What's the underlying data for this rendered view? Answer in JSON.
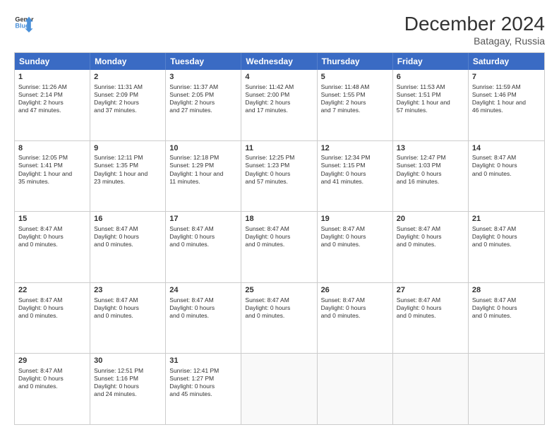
{
  "logo": {
    "line1": "General",
    "line2": "Blue",
    "icon_color": "#4a90d9"
  },
  "title": "December 2024",
  "location": "Batagay, Russia",
  "header_days": [
    "Sunday",
    "Monday",
    "Tuesday",
    "Wednesday",
    "Thursday",
    "Friday",
    "Saturday"
  ],
  "rows": [
    [
      {
        "day": "1",
        "info": "Sunrise: 11:26 AM\nSunset: 2:14 PM\nDaylight: 2 hours\nand 47 minutes."
      },
      {
        "day": "2",
        "info": "Sunrise: 11:31 AM\nSunset: 2:09 PM\nDaylight: 2 hours\nand 37 minutes."
      },
      {
        "day": "3",
        "info": "Sunrise: 11:37 AM\nSunset: 2:05 PM\nDaylight: 2 hours\nand 27 minutes."
      },
      {
        "day": "4",
        "info": "Sunrise: 11:42 AM\nSunset: 2:00 PM\nDaylight: 2 hours\nand 17 minutes."
      },
      {
        "day": "5",
        "info": "Sunrise: 11:48 AM\nSunset: 1:55 PM\nDaylight: 2 hours\nand 7 minutes."
      },
      {
        "day": "6",
        "info": "Sunrise: 11:53 AM\nSunset: 1:51 PM\nDaylight: 1 hour and\n57 minutes."
      },
      {
        "day": "7",
        "info": "Sunrise: 11:59 AM\nSunset: 1:46 PM\nDaylight: 1 hour and\n46 minutes."
      }
    ],
    [
      {
        "day": "8",
        "info": "Sunrise: 12:05 PM\nSunset: 1:41 PM\nDaylight: 1 hour and\n35 minutes."
      },
      {
        "day": "9",
        "info": "Sunrise: 12:11 PM\nSunset: 1:35 PM\nDaylight: 1 hour and\n23 minutes."
      },
      {
        "day": "10",
        "info": "Sunrise: 12:18 PM\nSunset: 1:29 PM\nDaylight: 1 hour and\n11 minutes."
      },
      {
        "day": "11",
        "info": "Sunrise: 12:25 PM\nSunset: 1:23 PM\nDaylight: 0 hours\nand 57 minutes."
      },
      {
        "day": "12",
        "info": "Sunrise: 12:34 PM\nSunset: 1:15 PM\nDaylight: 0 hours\nand 41 minutes."
      },
      {
        "day": "13",
        "info": "Sunrise: 12:47 PM\nSunset: 1:03 PM\nDaylight: 0 hours\nand 16 minutes."
      },
      {
        "day": "14",
        "info": "Sunset: 8:47 AM\nDaylight: 0 hours\nand 0 minutes."
      }
    ],
    [
      {
        "day": "15",
        "info": "Sunset: 8:47 AM\nDaylight: 0 hours\nand 0 minutes."
      },
      {
        "day": "16",
        "info": "Sunset: 8:47 AM\nDaylight: 0 hours\nand 0 minutes."
      },
      {
        "day": "17",
        "info": "Sunset: 8:47 AM\nDaylight: 0 hours\nand 0 minutes."
      },
      {
        "day": "18",
        "info": "Sunset: 8:47 AM\nDaylight: 0 hours\nand 0 minutes."
      },
      {
        "day": "19",
        "info": "Sunset: 8:47 AM\nDaylight: 0 hours\nand 0 minutes."
      },
      {
        "day": "20",
        "info": "Sunset: 8:47 AM\nDaylight: 0 hours\nand 0 minutes."
      },
      {
        "day": "21",
        "info": "Sunset: 8:47 AM\nDaylight: 0 hours\nand 0 minutes."
      }
    ],
    [
      {
        "day": "22",
        "info": "Sunset: 8:47 AM\nDaylight: 0 hours\nand 0 minutes."
      },
      {
        "day": "23",
        "info": "Sunset: 8:47 AM\nDaylight: 0 hours\nand 0 minutes."
      },
      {
        "day": "24",
        "info": "Sunset: 8:47 AM\nDaylight: 0 hours\nand 0 minutes."
      },
      {
        "day": "25",
        "info": "Sunset: 8:47 AM\nDaylight: 0 hours\nand 0 minutes."
      },
      {
        "day": "26",
        "info": "Sunset: 8:47 AM\nDaylight: 0 hours\nand 0 minutes."
      },
      {
        "day": "27",
        "info": "Sunset: 8:47 AM\nDaylight: 0 hours\nand 0 minutes."
      },
      {
        "day": "28",
        "info": "Sunset: 8:47 AM\nDaylight: 0 hours\nand 0 minutes."
      }
    ],
    [
      {
        "day": "29",
        "info": "Sunset: 8:47 AM\nDaylight: 0 hours\nand 0 minutes."
      },
      {
        "day": "30",
        "info": "Sunrise: 12:51 PM\nSunset: 1:16 PM\nDaylight: 0 hours\nand 24 minutes."
      },
      {
        "day": "31",
        "info": "Sunrise: 12:41 PM\nSunset: 1:27 PM\nDaylight: 0 hours\nand 45 minutes."
      },
      {
        "day": "",
        "info": ""
      },
      {
        "day": "",
        "info": ""
      },
      {
        "day": "",
        "info": ""
      },
      {
        "day": "",
        "info": ""
      }
    ]
  ]
}
